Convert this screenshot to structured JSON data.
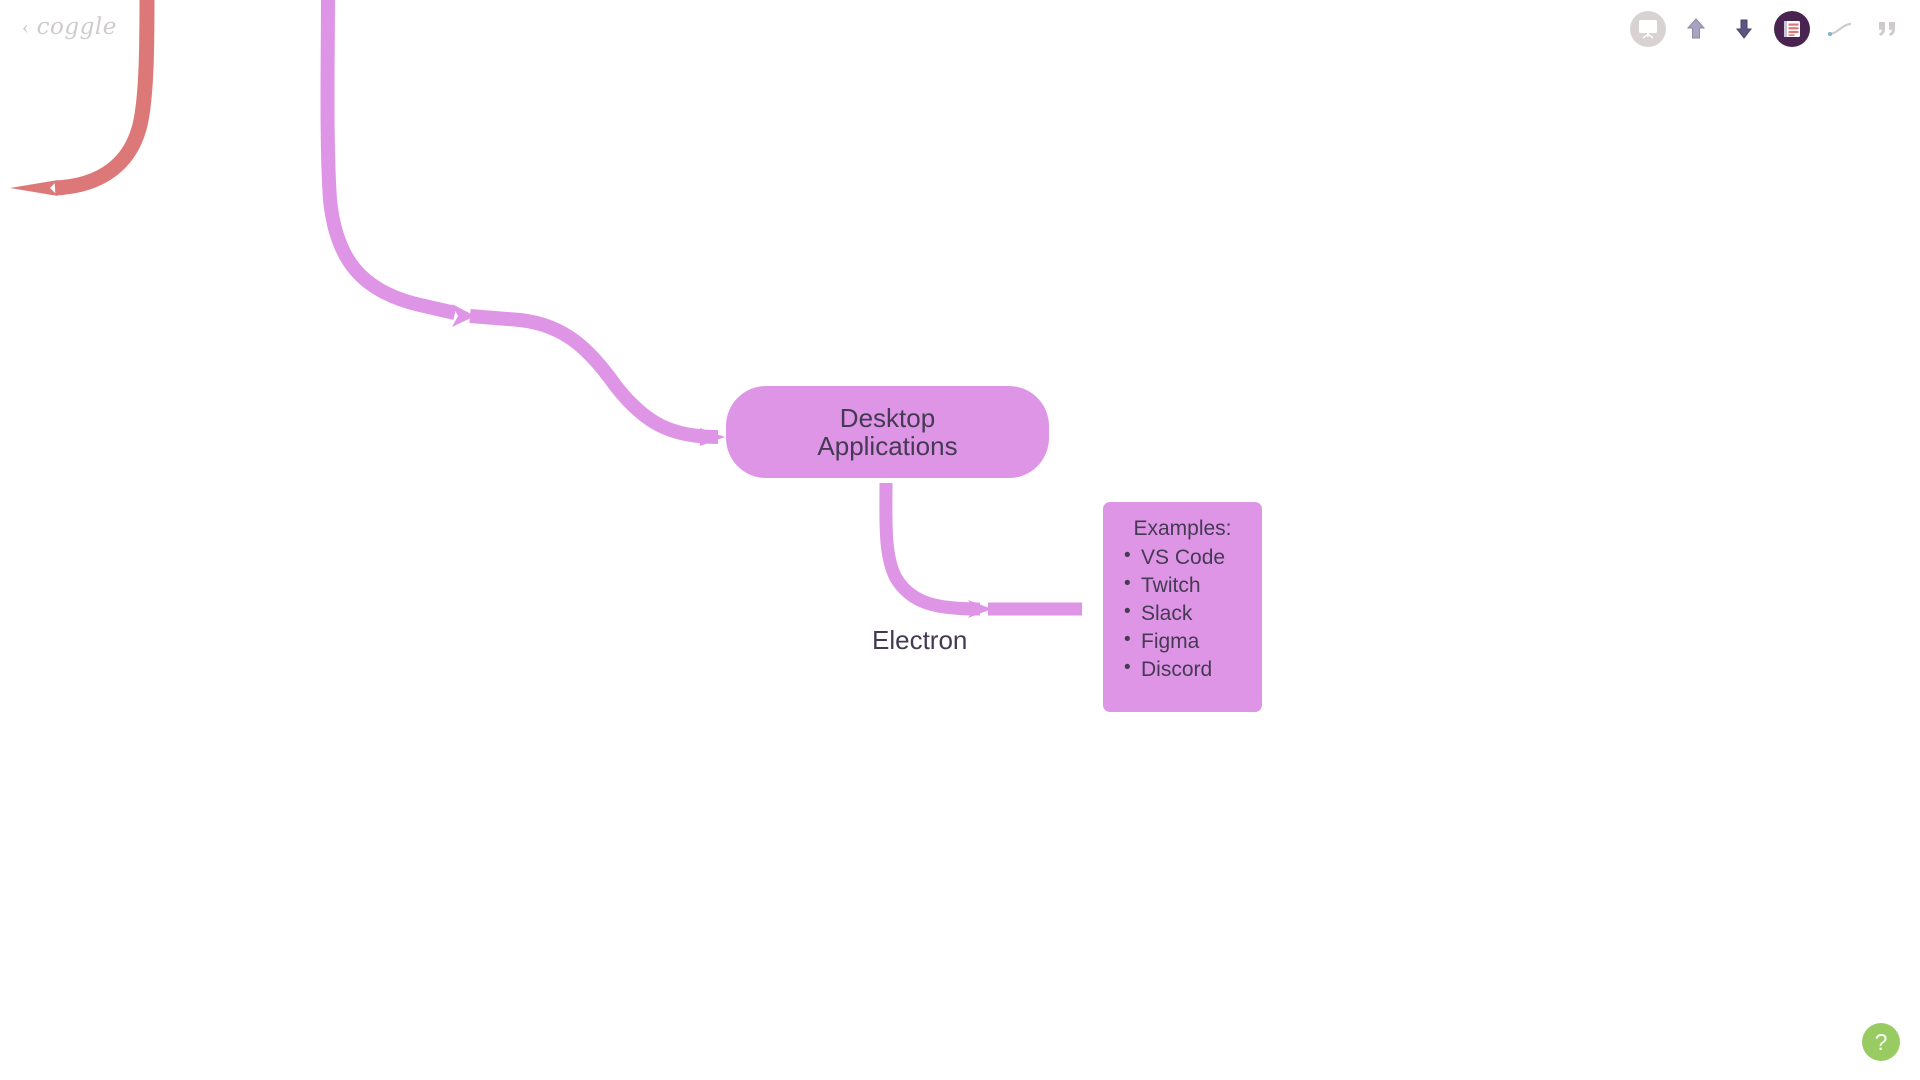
{
  "app": {
    "name": "Coggle",
    "background_color": "#ffffff"
  },
  "logo": {
    "back_chevron": "‹",
    "wordmark": "coggle",
    "color": "#cfcbcd"
  },
  "toolbar": {
    "items": [
      {
        "name": "presentation-icon",
        "label": "Present",
        "active": false
      },
      {
        "name": "upload-icon",
        "label": "Upload",
        "active": false
      },
      {
        "name": "download-icon",
        "label": "Download",
        "active": false
      },
      {
        "name": "document-icon",
        "label": "Documents",
        "active": true
      },
      {
        "name": "line-style-icon",
        "label": "Line style",
        "active": false
      },
      {
        "name": "quote-icon",
        "label": "Quote",
        "active": false
      }
    ]
  },
  "mindmap": {
    "nodes": [
      {
        "id": "desktop-applications",
        "label": "Desktop\nApplications",
        "line1": "Desktop",
        "line2": "Applications",
        "shape": "pill",
        "color": "#de95e6",
        "text_color": "#453a53"
      },
      {
        "id": "electron",
        "label": "Electron",
        "shape": "text",
        "text_color": "#453a53"
      },
      {
        "id": "examples",
        "shape": "rounded-rect",
        "color": "#de95e6",
        "text_color": "#453a53",
        "title": "Examples:",
        "items": [
          "VS Code",
          "Twitch",
          "Slack",
          "Figma",
          "Discord"
        ]
      }
    ],
    "branches": [
      {
        "id": "incoming-red-branch",
        "color": "#dd7878",
        "direction": "left-offscreen"
      },
      {
        "id": "incoming-purple-branch",
        "color": "#de95e6",
        "direction": "top-to-desktop-applications"
      },
      {
        "id": "desktop-to-electron-branch",
        "color": "#de95e6",
        "direction": "down-then-right"
      }
    ]
  },
  "help": {
    "label": "?",
    "color": "#98cc63"
  }
}
